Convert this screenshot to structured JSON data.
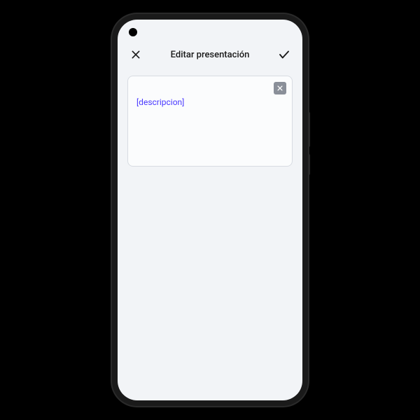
{
  "header": {
    "title": "Editar presentación",
    "close_label": "close",
    "confirm_label": "confirm"
  },
  "card": {
    "placeholder": "[descripcion]",
    "close_label": "remove"
  }
}
